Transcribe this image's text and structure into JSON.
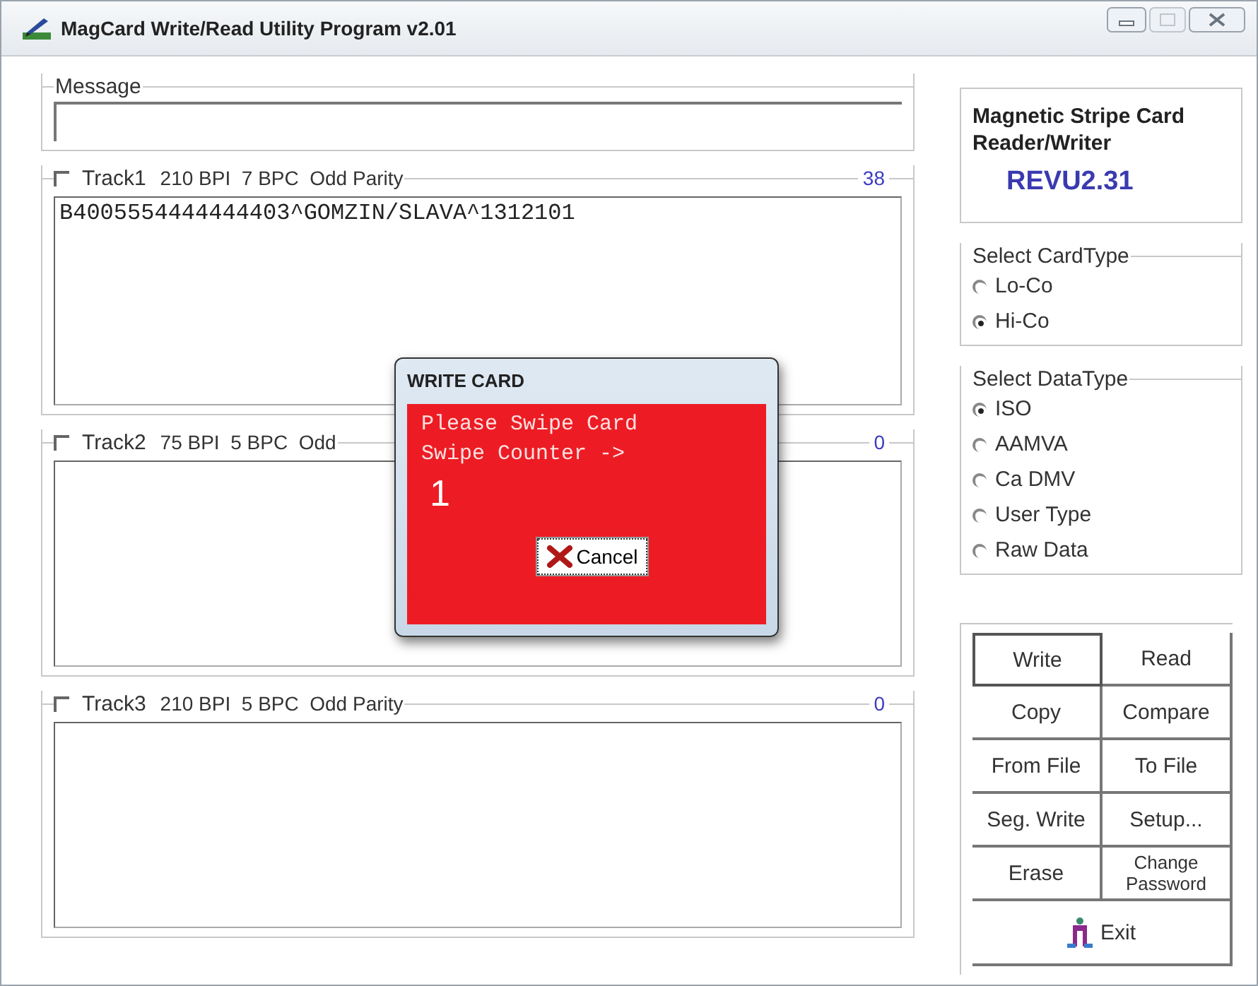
{
  "window": {
    "title": "MagCard Write/Read Utility Program v2.01"
  },
  "message": {
    "label": "Message"
  },
  "tracks": [
    {
      "label": "Track1",
      "settings": "210 BPI  7 BPC  Odd Parity",
      "count": "38",
      "checked": false,
      "data": "B4005554444444403^GOMZIN/SLAVA^1312101"
    },
    {
      "label": "Track2",
      "settings": "75 BPI  5 BPC  Odd",
      "count": "0",
      "checked": false
    },
    {
      "label": "Track3",
      "settings": "210 BPI  5 BPC  Odd Parity",
      "count": "0",
      "checked": false
    }
  ],
  "info": {
    "title": "Magnetic Stripe Card Reader/Writer",
    "revision": "REVU2.31"
  },
  "card_type": {
    "label": "Select CardType",
    "options": [
      {
        "label": "Lo-Co",
        "selected": false
      },
      {
        "label": "Hi-Co",
        "selected": true
      }
    ]
  },
  "data_type": {
    "label": "Select DataType",
    "options": [
      {
        "label": "ISO",
        "selected": true
      },
      {
        "label": "AAMVA",
        "selected": false
      },
      {
        "label": "Ca DMV",
        "selected": false
      },
      {
        "label": "User Type",
        "selected": false
      },
      {
        "label": "Raw Data",
        "selected": false
      }
    ]
  },
  "buttons": [
    {
      "label": "Write",
      "kind": "single"
    },
    {
      "label": "Read",
      "kind": "single"
    },
    {
      "label": "Copy",
      "kind": "single"
    },
    {
      "label": "Compare",
      "kind": "single"
    },
    {
      "label": "From File",
      "kind": "single"
    },
    {
      "label": "To File",
      "kind": "single"
    },
    {
      "label": "Seg. Write",
      "kind": "single"
    },
    {
      "label": "Setup...",
      "kind": "single"
    },
    {
      "label": "Erase",
      "kind": "single"
    },
    {
      "label": "Change Password",
      "kind": "small"
    },
    {
      "label": "Exit",
      "kind": "exit"
    }
  ],
  "dialog": {
    "title": "WRITE CARD",
    "lines": [
      "Please Swipe Card",
      "Swipe Counter ->"
    ],
    "counter": "1",
    "button": "Cancel"
  }
}
